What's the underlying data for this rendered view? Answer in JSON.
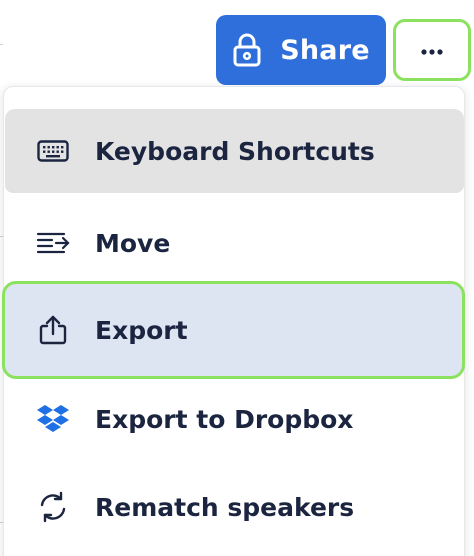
{
  "toolbar": {
    "share_label": "Share",
    "share_icon": "lock-icon",
    "more_icon": "more-horizontal-icon"
  },
  "menu": {
    "items": [
      {
        "label": "Keyboard Shortcuts",
        "icon": "keyboard-icon",
        "state": "hovered"
      },
      {
        "label": "Move",
        "icon": "move-list-icon"
      },
      {
        "label": "Export",
        "icon": "upload-icon",
        "state": "focused"
      },
      {
        "label": "Export to Dropbox",
        "icon": "dropbox-icon"
      },
      {
        "label": "Rematch speakers",
        "icon": "refresh-icon"
      }
    ]
  },
  "colors": {
    "accent": "#2f6fdc",
    "focus_ring": "#8be25f",
    "text": "#1b2540",
    "hover_bg": "#e3e3e4",
    "selected_bg": "#dde5f3",
    "dropbox": "#1f6fe5"
  }
}
